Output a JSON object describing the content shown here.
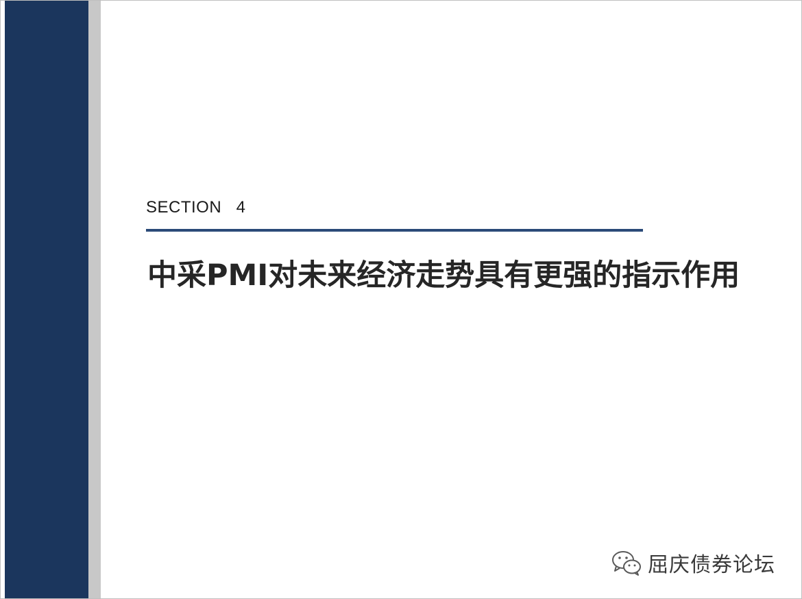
{
  "slide": {
    "section_label": "SECTION   4",
    "title": "中采PMI对未来经济走势具有更强的指示作用"
  },
  "watermark": {
    "icon": "wechat-icon",
    "text": "屈庆债券论坛"
  },
  "colors": {
    "band": "#1b365d",
    "strip": "#c8c8c8",
    "rule": "#2b4a78",
    "title": "#262626"
  }
}
